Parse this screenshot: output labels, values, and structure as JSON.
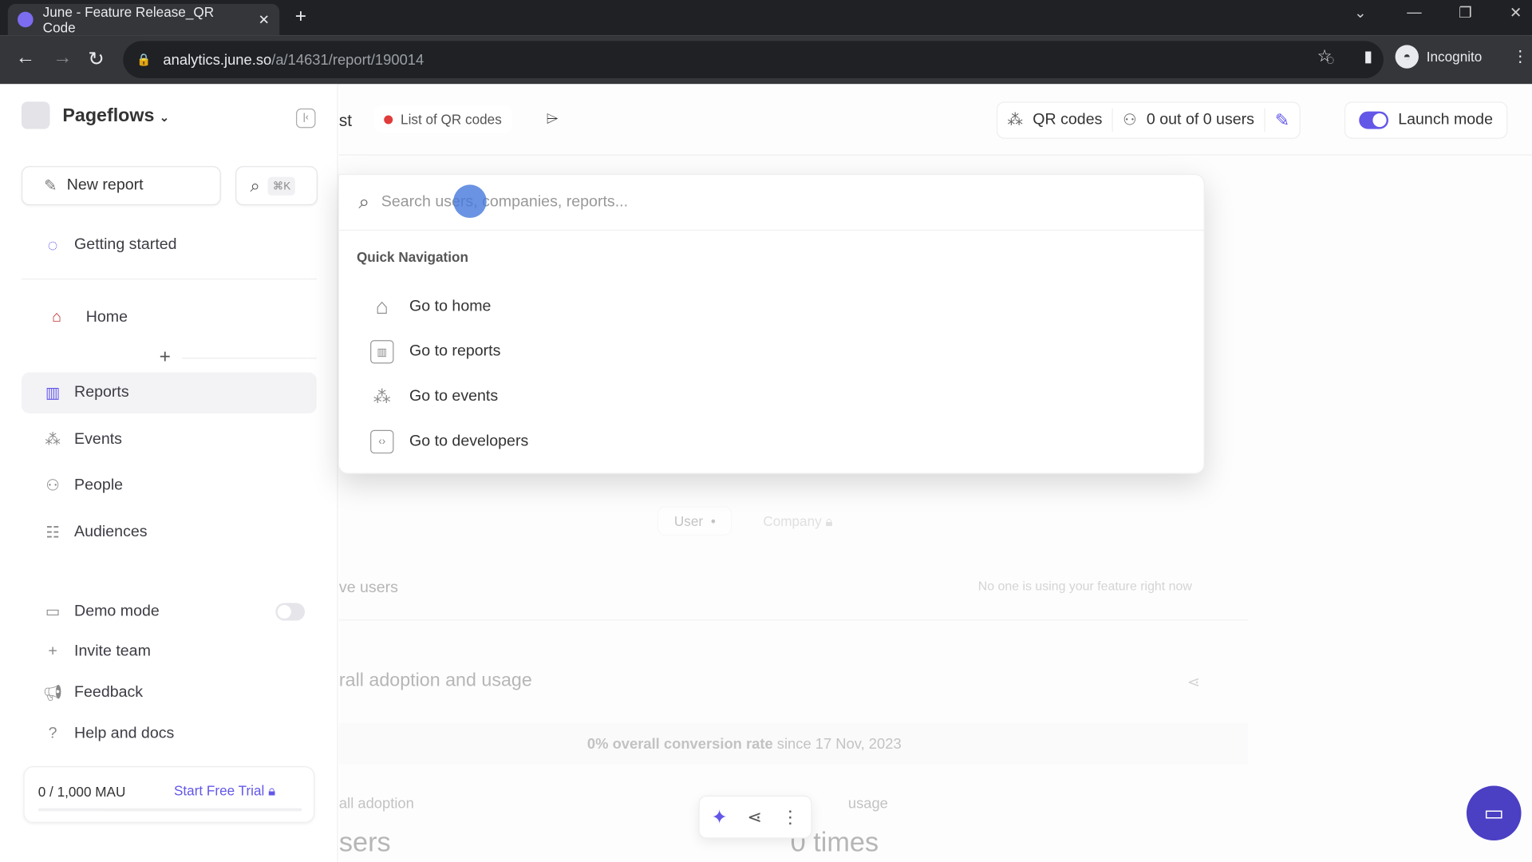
{
  "browser": {
    "tab_title": "June - Feature Release_QR Code",
    "url_host": "analytics.june.so",
    "url_path": "/a/14631/report/190014",
    "profile": "Incognito"
  },
  "sidebar": {
    "workspace": "Pageflows",
    "new_report": "New report",
    "search_shortcut": "⌘K",
    "getting_started": "Getting started",
    "home": "Home",
    "items": [
      {
        "label": "Reports",
        "icon": "reports-icon",
        "active": true
      },
      {
        "label": "Events",
        "icon": "events-icon"
      },
      {
        "label": "People",
        "icon": "people-icon"
      },
      {
        "label": "Audiences",
        "icon": "audiences-icon"
      }
    ],
    "demo_mode": "Demo mode",
    "demo_mode_on": false,
    "invite_team": "Invite team",
    "feedback": "Feedback",
    "help": "Help and docs",
    "mau": "0 / 1,000 MAU",
    "trial": "Start Free Trial",
    "mau_progress": 0
  },
  "header": {
    "breadcrumb_fragment": "st",
    "list_tag": "List of QR codes",
    "event": "QR codes",
    "users": "0 out of 0 users",
    "launch_mode": "Launch mode",
    "launch_mode_on": true
  },
  "background": {
    "user_tab": "User",
    "company_tab": "Company",
    "active_users": "ve users",
    "empty_msg": "No one is using your feature right now",
    "adoption_title": "rall adoption and usage",
    "conversion_bold": "0% overall conversion rate",
    "conversion_rest": " since 17 Nov, 2023",
    "adoption": "all adoption",
    "usage": "usage",
    "users_value": "sers",
    "times_value": "0 times"
  },
  "palette": {
    "search_placeholder": "Search users, companies, reports...",
    "section": "Quick Navigation",
    "items": [
      "Go to home",
      "Go to reports",
      "Go to events",
      "Go to developers"
    ]
  },
  "colors": {
    "accent": "#6357e8",
    "status_dot": "#e03c3c"
  }
}
